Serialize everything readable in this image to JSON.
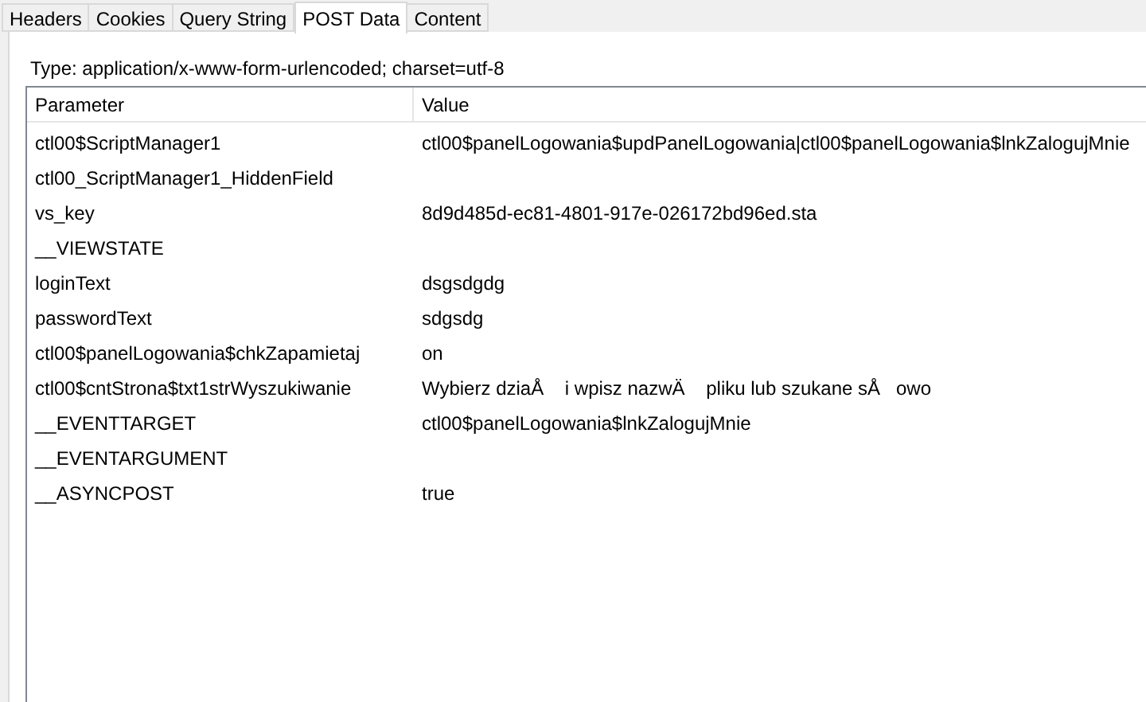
{
  "tabs": [
    {
      "label": "Headers",
      "selected": false
    },
    {
      "label": "Cookies",
      "selected": false
    },
    {
      "label": "Query String",
      "selected": false
    },
    {
      "label": "POST Data",
      "selected": true
    },
    {
      "label": "Content",
      "selected": false
    }
  ],
  "content_type": "Type: application/x-www-form-urlencoded; charset=utf-8",
  "table": {
    "columns": [
      "Parameter",
      "Value"
    ],
    "rows": [
      {
        "parameter": "ctl00$ScriptManager1",
        "value": "ctl00$panelLogowania$updPanelLogowania|ctl00$panelLogowania$lnkZalogujMnie"
      },
      {
        "parameter": "ctl00_ScriptManager1_HiddenField"
      },
      {
        "parameter": "vs_key",
        "value": "8d9d485d-ec81-4801-917e-026172bd96ed.sta"
      },
      {
        "parameter": "__VIEWSTATE"
      },
      {
        "parameter": "loginText",
        "value": "dsgsdgdg"
      },
      {
        "parameter": "passwordText",
        "value": "sdgsdg"
      },
      {
        "parameter": "ctl00$panelLogowania$chkZapamietaj",
        "value": "on"
      },
      {
        "parameter": "ctl00$cntStrona$txt1strWyszukiwanie",
        "value": "Wybierz dziaÅ i wpisz nazwÄ pliku lub szukane sÅowo"
      },
      {
        "parameter": "__EVENTTARGET",
        "value": "ctl00$panelLogowania$lnkZalogujMnie"
      },
      {
        "parameter": "__EVENTARGUMENT"
      },
      {
        "parameter": "__ASYNCPOST",
        "value": "true"
      }
    ]
  }
}
